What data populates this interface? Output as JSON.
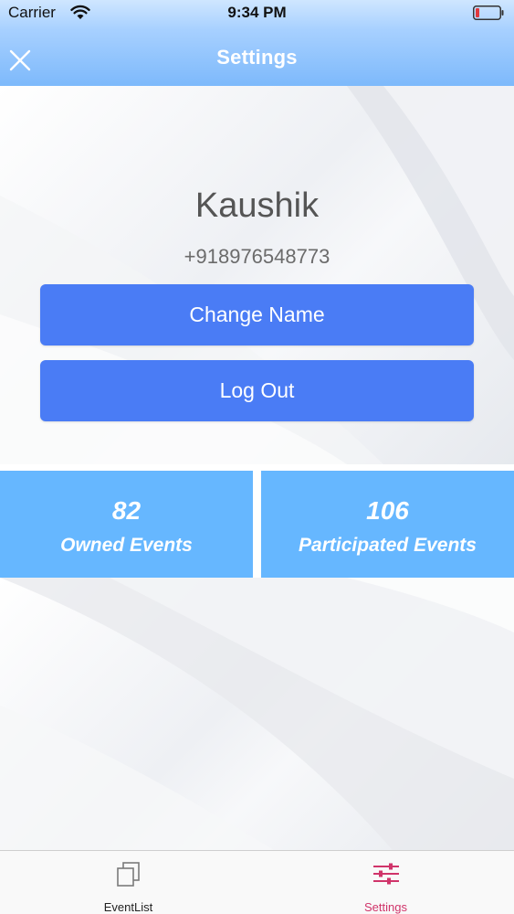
{
  "status_bar": {
    "carrier": "Carrier",
    "time": "9:34 PM",
    "wifi_icon": "wifi-icon",
    "battery_icon": "battery-low-icon"
  },
  "nav": {
    "title": "Settings",
    "close_icon": "close-icon"
  },
  "profile": {
    "name": "Kaushik",
    "phone": "+918976548773"
  },
  "actions": {
    "change_name_label": "Change Name",
    "logout_label": "Log Out"
  },
  "stats": {
    "owned_value": "82",
    "owned_label": "Owned Events",
    "participated_value": "106",
    "participated_label": "Participated Events"
  },
  "tabs": [
    {
      "label": "EventList",
      "icon": "copy-icon",
      "active": false
    },
    {
      "label": "Settings",
      "icon": "sliders-icon",
      "active": true
    }
  ],
  "colors": {
    "header_bottom": "#7db9fb",
    "button": "#4a7cf5",
    "stat_tile": "#66b7ff",
    "active_tab": "#d0346a",
    "battery": "#e0393e"
  }
}
